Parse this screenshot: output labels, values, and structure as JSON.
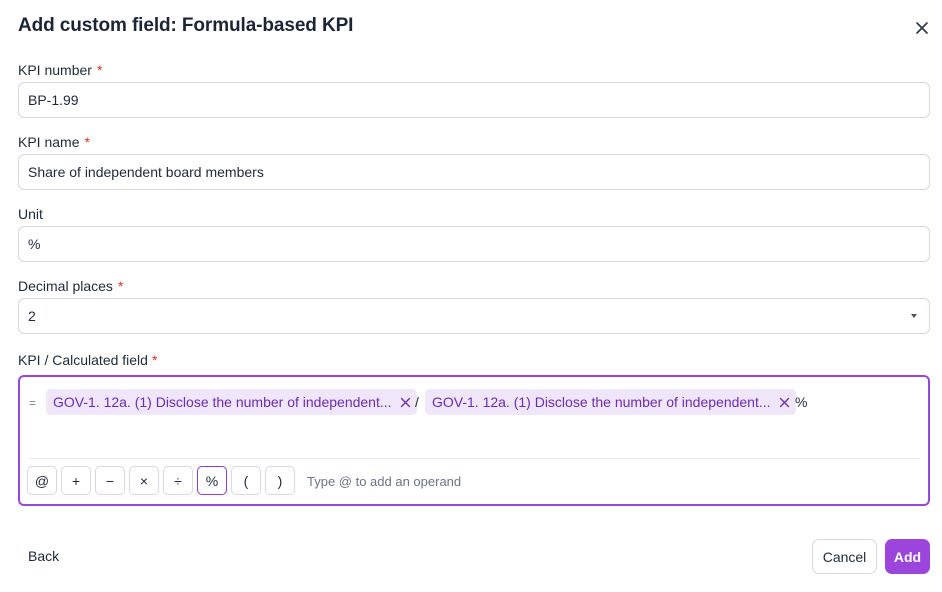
{
  "dialog": {
    "title": "Add custom field: Formula-based KPI"
  },
  "fields": {
    "kpi_number": {
      "label": "KPI number",
      "required_mark": "*",
      "value": "BP-1.99"
    },
    "kpi_name": {
      "label": "KPI name",
      "required_mark": "*",
      "value": "Share of independent board members"
    },
    "unit": {
      "label": "Unit",
      "value": "%"
    },
    "decimal_places": {
      "label": "Decimal places",
      "required_mark": "*",
      "selected": "2"
    }
  },
  "formula": {
    "label": "KPI / Calculated field",
    "required_mark": "*",
    "equals": "=",
    "operand_1": "GOV-1. 12a. (1) Disclose the number of independent...",
    "operator": "/",
    "operand_2": "GOV-1. 12a. (1) Disclose the number of independent...",
    "suffix": "%",
    "toolbar": {
      "at": "@",
      "plus": "+",
      "minus": "−",
      "times": "×",
      "divide": "÷",
      "percent": "%",
      "open_paren": "(",
      "close_paren": ")"
    },
    "hint": "Type @ to add an operand"
  },
  "footer": {
    "back": "Back",
    "cancel": "Cancel",
    "add": "Add"
  },
  "colors": {
    "accent": "#9b45dd",
    "chip_bg": "#efe6fa",
    "chip_text": "#6c2cb3",
    "required": "#d4351c"
  }
}
